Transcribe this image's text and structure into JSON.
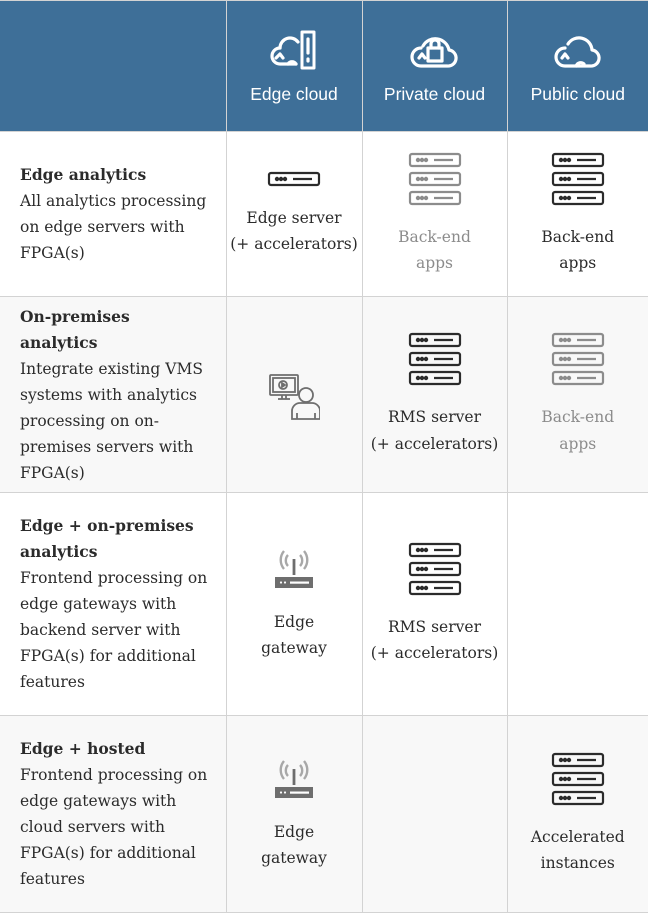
{
  "colors": {
    "header_bg": "#3e6f98",
    "header_text": "#ffffff",
    "text": "#2b2b2b",
    "muted_text": "#8c8c8c",
    "icon_dark": "#2b2b2b",
    "icon_muted": "#8c8c8c",
    "grid_line": "#d3d3d3",
    "alt_row_bg": "#f8f8f8"
  },
  "header": {
    "columns": [
      {
        "label": "",
        "icon": ""
      },
      {
        "label": "Edge cloud",
        "icon": "edge-cloud-icon"
      },
      {
        "label": "Private cloud",
        "icon": "private-cloud-lock-icon"
      },
      {
        "label": "Public cloud",
        "icon": "public-cloud-icon"
      }
    ]
  },
  "rows": [
    {
      "title": "Edge analytics",
      "description": "All analytics processing on edge servers with FPGA(s)",
      "cells": [
        {
          "icon": "single-server-icon",
          "label": "Edge server\n(+ accelerators)",
          "muted": false
        },
        {
          "icon": "server-stack-icon",
          "label": "Back-end\napps",
          "muted": true
        },
        {
          "icon": "server-stack-icon",
          "label": "Back-end\napps",
          "muted": false
        }
      ]
    },
    {
      "title": "On-premises analytics",
      "description": "Integrate existing VMS systems with analytics processing on on-premises servers with FPGA(s)",
      "cells": [
        {
          "icon": "vms-operator-icon",
          "label": "",
          "muted": true
        },
        {
          "icon": "server-stack-icon",
          "label": "RMS server\n(+ accelerators)",
          "muted": false
        },
        {
          "icon": "server-stack-icon",
          "label": "Back-end\napps",
          "muted": true
        }
      ]
    },
    {
      "title": "Edge + on-premises analytics",
      "description": "Frontend processing on edge gateways with backend server with FPGA(s) for additional features",
      "cells": [
        {
          "icon": "edge-gateway-icon",
          "label": "Edge\ngateway",
          "muted": false
        },
        {
          "icon": "server-stack-icon",
          "label": "RMS server\n(+ accelerators)",
          "muted": false
        },
        {
          "icon": "",
          "label": "",
          "muted": false
        }
      ]
    },
    {
      "title": "Edge + hosted",
      "description": "Frontend processing on edge gateways with cloud servers with FPGA(s) for additional features",
      "cells": [
        {
          "icon": "edge-gateway-icon",
          "label": "Edge\ngateway",
          "muted": false
        },
        {
          "icon": "",
          "label": "",
          "muted": false
        },
        {
          "icon": "server-stack-icon",
          "label": "Accelerated\ninstances",
          "muted": false
        }
      ]
    }
  ]
}
